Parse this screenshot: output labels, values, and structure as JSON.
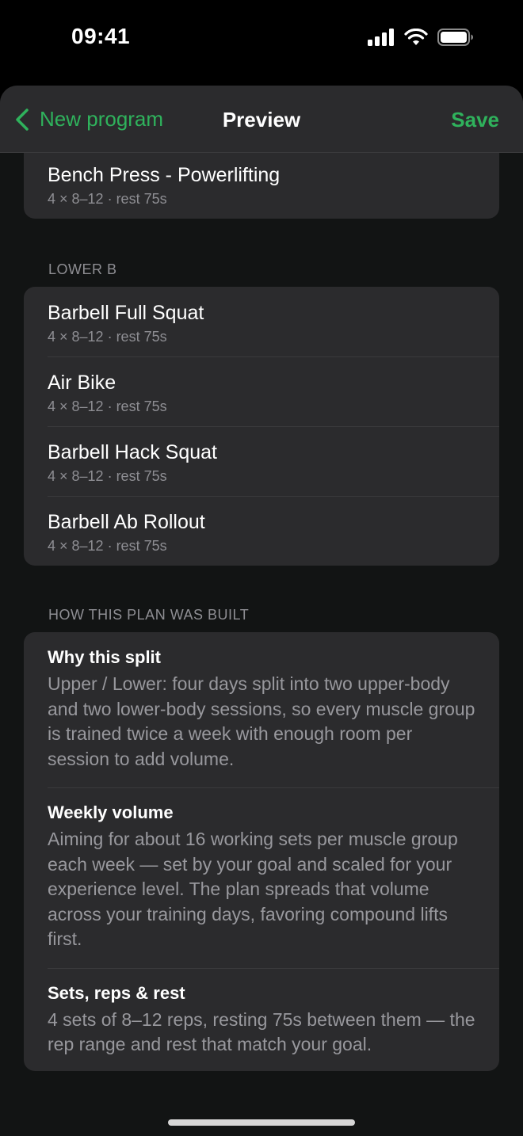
{
  "status_bar": {
    "time": "09:41"
  },
  "nav": {
    "back_label": "New program",
    "title": "Preview",
    "save_label": "Save"
  },
  "top_card": {
    "exercise": {
      "name": "Bench Press - Powerlifting",
      "detail": "4 × 8–12 · rest 75s"
    }
  },
  "lower_b": {
    "label": "LOWER B",
    "exercises": [
      {
        "name": "Barbell Full Squat",
        "detail": "4 × 8–12 · rest 75s"
      },
      {
        "name": "Air Bike",
        "detail": "4 × 8–12 · rest 75s"
      },
      {
        "name": "Barbell Hack Squat",
        "detail": "4 × 8–12 · rest 75s"
      },
      {
        "name": "Barbell Ab Rollout",
        "detail": "4 × 8–12 · rest 75s"
      }
    ]
  },
  "how_built": {
    "label": "HOW THIS PLAN WAS BUILT",
    "blocks": [
      {
        "title": "Why this split",
        "body": "Upper / Lower: four days split into two upper-body and two lower-body sessions, so every muscle group is trained twice a week with enough room per session to add volume."
      },
      {
        "title": "Weekly volume",
        "body": "Aiming for about 16 working sets per muscle group each week — set by your goal and scaled for your experience level. The plan spreads that volume across your training days, favoring compound lifts first."
      },
      {
        "title": "Sets, reps & rest",
        "body": "4 sets of 8–12 reps, resting 75s between them — the rep range and rest that match your goal."
      }
    ]
  },
  "colors": {
    "accent": "#2fb25c",
    "card": "#2b2b2d",
    "background": "#121414"
  }
}
